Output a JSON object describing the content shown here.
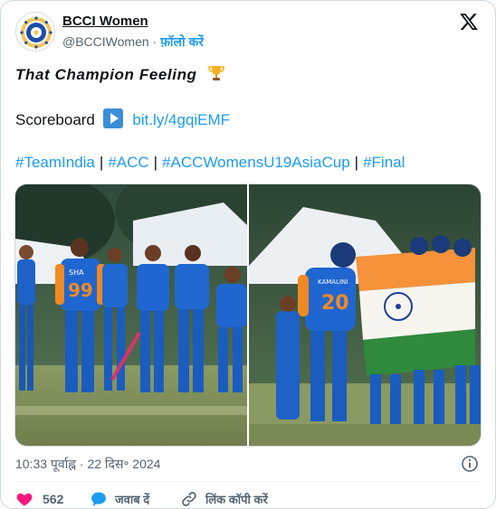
{
  "author": {
    "name": "BCCI Women",
    "handle": "@BCCIWomen",
    "separator": "·",
    "follow_label": "फ़ॉलो करें",
    "avatar_icon": "bcci-logo-icon"
  },
  "post": {
    "title": "That Champion Feeling",
    "title_emoji": "trophy-icon",
    "scoreboard_label": "Scoreboard",
    "scoreboard_link": "bit.ly/4gqiEMF",
    "hashtags": [
      "#TeamIndia",
      "#ACC",
      "#ACCWomensU19AsiaCup",
      "#Final"
    ],
    "hashtag_separator": "|"
  },
  "media": {
    "left_jerseys": [
      "SHA",
      "99"
    ],
    "right_jerseys": [
      "KAMALINI",
      "20"
    ]
  },
  "meta": {
    "time": "10:33 पूर्वाह्न",
    "dot": "·",
    "date": "22 दिस॰ 2024"
  },
  "actions": {
    "like_count": "562",
    "reply_label": "जवाब दें",
    "copy_label": "लिंक कॉपी करें"
  },
  "colors": {
    "link": "#1d9bf0",
    "like": "#f91880",
    "muted": "#536471"
  }
}
